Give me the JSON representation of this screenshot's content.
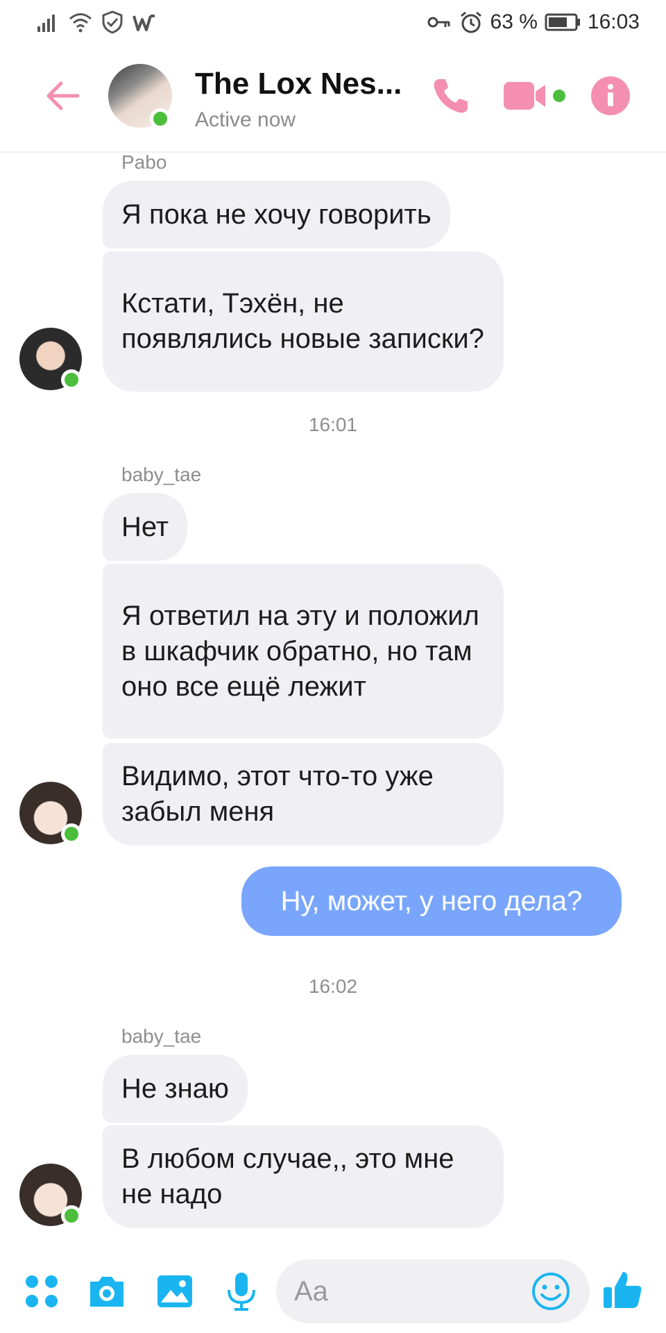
{
  "status_bar": {
    "battery": "63 %",
    "time": "16:03",
    "icons": [
      "signal-icon",
      "wifi-icon",
      "shield-icon",
      "app-w-icon",
      "key-icon",
      "alarm-icon",
      "battery-icon"
    ]
  },
  "header": {
    "title": "The Lox Nes...",
    "status": "Active now",
    "icons": [
      "back-arrow-icon",
      "phone-icon",
      "video-icon",
      "info-icon"
    ],
    "accent_color": "#f48fb1"
  },
  "messages": {
    "g1": {
      "sender": "Pabo",
      "m1": "Я пока не хочу говорить",
      "m2": "Кстати, Тэхён, не появлялись новые записки?"
    },
    "ts1": "16:01",
    "g2": {
      "sender": "baby_tae",
      "m1": "Нет",
      "m2": "Я ответил на эту и положил в шкафчик обратно, но там оно все ещё лежит",
      "m3": "Видимо, этот что-то уже забыл меня"
    },
    "out1": "Ну, может, у него дела?",
    "ts2": "16:02",
    "g3": {
      "sender": "baby_tae",
      "m1": "Не знаю",
      "m2": "В любом случае,, это мне не надо"
    }
  },
  "composer": {
    "placeholder": "Aa",
    "icons": [
      "apps-icon",
      "camera-icon",
      "gallery-icon",
      "microphone-icon",
      "emoji-icon",
      "thumbs-up-icon"
    ],
    "accent_color": "#1ab5f0"
  },
  "colors": {
    "incoming_bubble": "#f0eff4",
    "outgoing_bubble": "#79a6fc",
    "online_dot": "#4cbe3c"
  }
}
